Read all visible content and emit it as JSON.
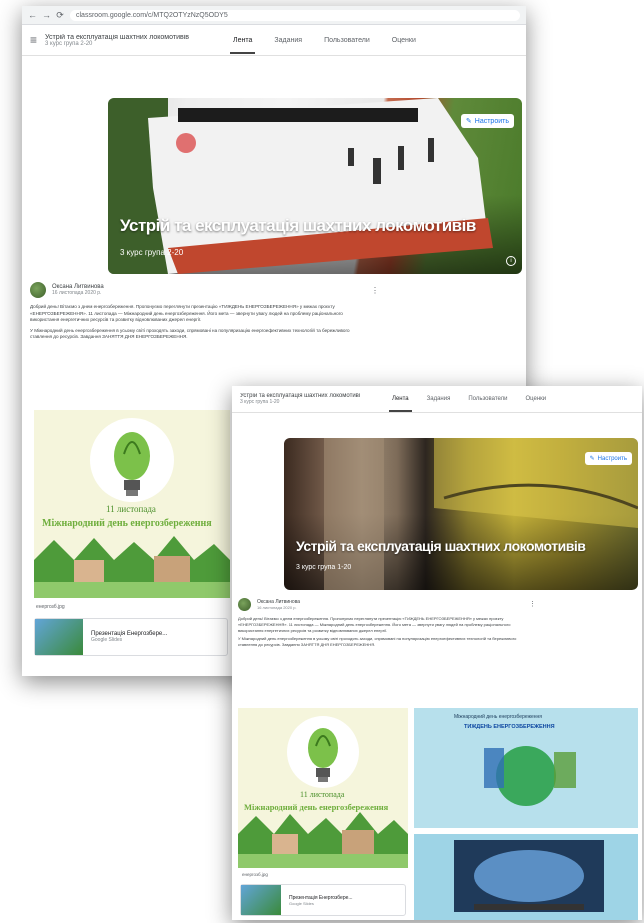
{
  "window1": {
    "browser": {
      "url": "classroom.google.com/c/MTQ2OTYzNzQ5ODY5",
      "back_glyph": "←",
      "forward_glyph": "→",
      "reload_glyph": "⟳"
    },
    "header": {
      "class_title": "Устрій та експлуатація шахтних локомотивів",
      "class_subtitle": "3 курс група 2-20"
    },
    "tabs": [
      "Лента",
      "Задания",
      "Пользователи",
      "Оценки"
    ],
    "banner": {
      "title": "Устрій та експлуатація шахтних локомотивів",
      "subtitle": "3 курс група 2-20",
      "customize_label": "Настроить"
    },
    "post": {
      "author": "Оксана Литвинова",
      "date": "16 листопада 2020 р.",
      "text": "Добрий день! Вітаємо з днем енергозбереження. Пропонуємо переглянути презентацію «ТИЖДЕНЬ ЕНЕРГОЗБЕРЕЖЕННЯ» у межах проєкту «ЕНЕРГОЗБЕРЕЖЕННЯ». 11 листопада — Міжнародний день енергозбереження. Його мета — звернути увагу людей на проблему раціонального використання енергетичних ресурсів та розвитку відновлюваних джерел енергії.",
      "text2": "У Міжнародний день енергозбереження в усьому світі проходять заходи, спрямовані на популяризацію енергоефективних технологій та бережливого ставлення до ресурсів. Завдання ЗАНЯТТЯ ДНЯ ЕНЕРГОЗБЕРЕЖЕННЯ.",
      "poster": {
        "date": "11 листопада",
        "title": "Міжнародний день енергозбереження"
      },
      "file_name": "енергозб.jpg",
      "attachment": {
        "title": "Презентація Енергозбере...",
        "type": "Google Slides"
      }
    }
  },
  "window2": {
    "header": {
      "class_title": "Устрій та експлуатація шахтних локомотивів",
      "class_subtitle": "3 курс група 1-20"
    },
    "tabs": [
      "Лента",
      "Задания",
      "Пользователи",
      "Оценки"
    ],
    "banner": {
      "title": "Устрій та експлуатація шахтних локомотивів",
      "subtitle": "3 курс група 1-20",
      "customize_label": "Настроить"
    },
    "post": {
      "author": "Оксана Литвинова",
      "date": "16 листопада 2020 р.",
      "text": "Добрий день! Вітаємо з днем енергозбереження. Пропонуємо переглянути презентацію «ТИЖДЕНЬ ЕНЕРГОЗБЕРЕЖЕННЯ» у межах проєкту «ЕНЕРГОЗБЕРЕЖЕННЯ». 11 листопада — Міжнародний день енергозбереження. Його мета — звернути увагу людей на проблему раціонального використання енергетичних ресурсів та розвитку відновлюваних джерел енергії.",
      "text2": "У Міжнародний день енергозбереження в усьому світі проходять заходи, спрямовані на популяризацію енергоефективних технологій та бережливого ставлення до ресурсів. Завдання ЗАНЯТТЯ ДНЯ ЕНЕРГОЗБЕРЕЖЕННЯ.",
      "poster": {
        "date": "11 листопада",
        "title": "Міжнародний день енергозбереження"
      },
      "file_name": "енергозб.jpg",
      "attachment": {
        "title": "Презентація Енергозбере...",
        "type": "Google Slides"
      },
      "slide": {
        "header": "Міжнародний день енергозбереження",
        "title": "ТИЖДЕНЬ ЕНЕРГОЗБЕРЕЖЕННЯ"
      }
    }
  },
  "icons": {
    "menu": "≡",
    "edit": "✎",
    "info": "i",
    "kebab": "⋮"
  },
  "colors": {
    "accent": "#1a73e8",
    "poster_green": "#6fae3d"
  }
}
